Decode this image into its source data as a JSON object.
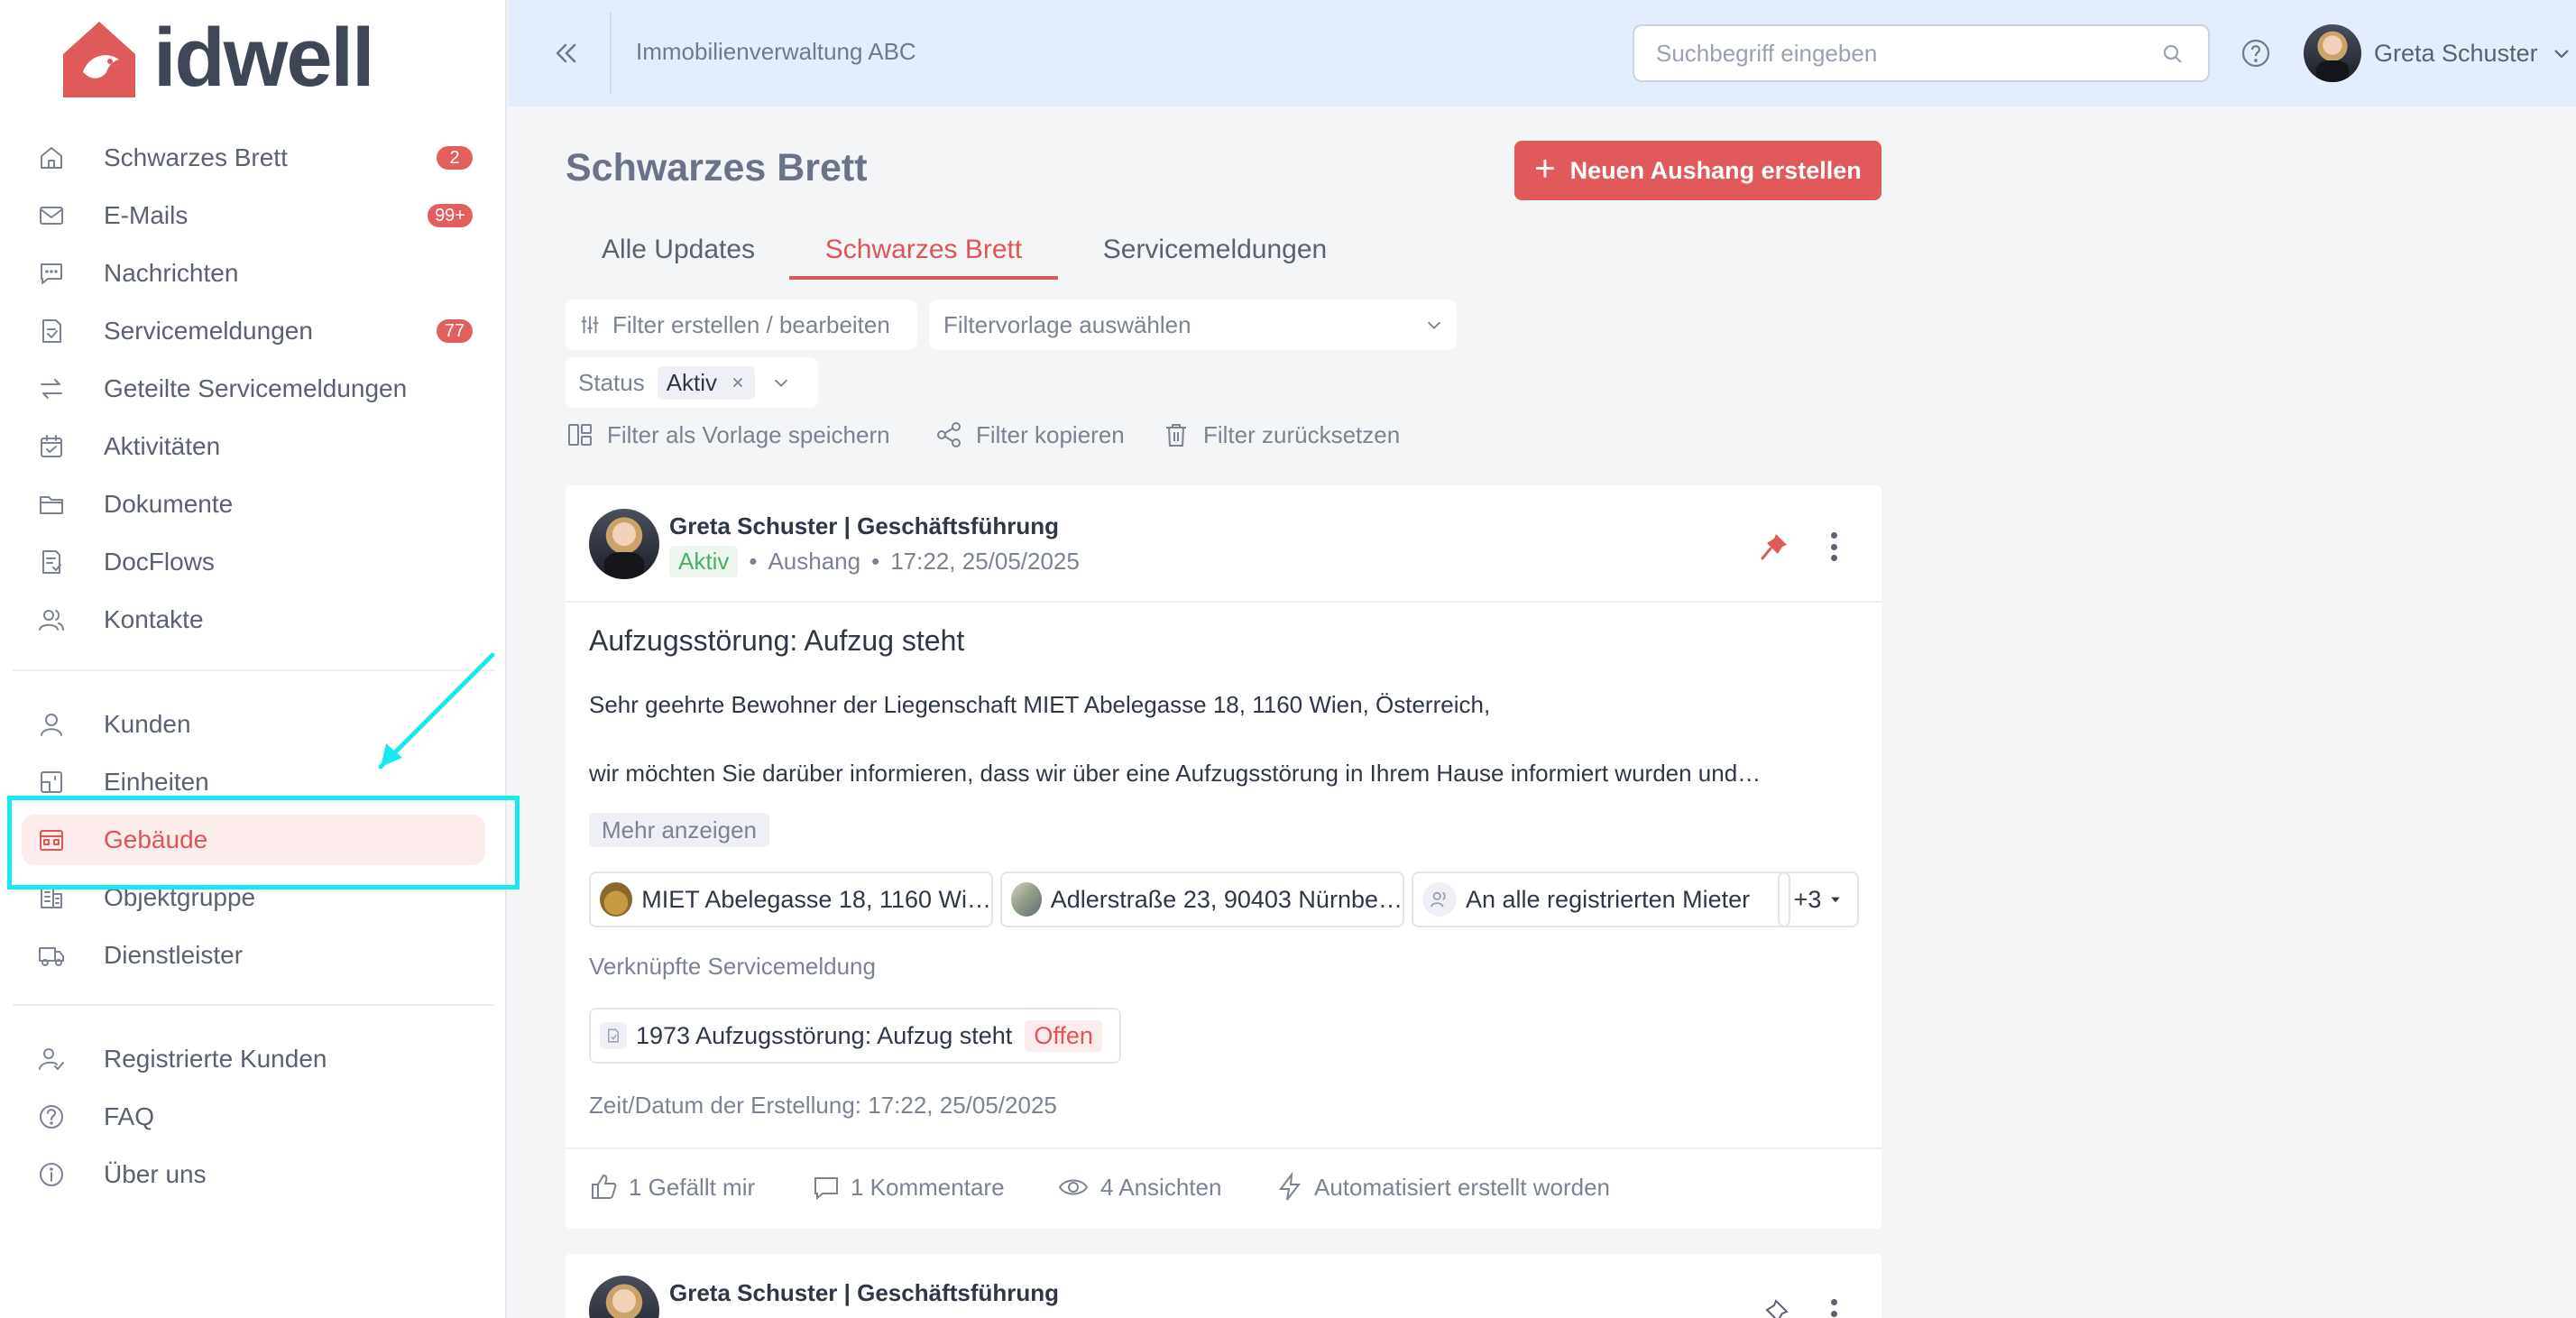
{
  "logo": {
    "text": "idwell"
  },
  "sidebar": {
    "items": [
      {
        "label": "Schwarzes Brett",
        "badge": "2",
        "icon": "home-icon"
      },
      {
        "label": "E-Mails",
        "badge": "99+",
        "icon": "mail-icon"
      },
      {
        "label": "Nachrichten",
        "badge": "",
        "icon": "chat-icon"
      },
      {
        "label": "Servicemeldungen",
        "badge": "77",
        "icon": "service-report-icon"
      },
      {
        "label": "Geteilte Servicemeldungen",
        "badge": "",
        "icon": "swap-arrows-icon"
      },
      {
        "label": "Aktivitäten",
        "badge": "",
        "icon": "calendar-check-icon"
      },
      {
        "label": "Dokumente",
        "badge": "",
        "icon": "folder-icon"
      },
      {
        "label": "DocFlows",
        "badge": "",
        "icon": "docflow-icon"
      },
      {
        "label": "Kontakte",
        "badge": "",
        "icon": "contacts-icon"
      },
      {
        "label": "Kunden",
        "badge": "",
        "icon": "user-icon"
      },
      {
        "label": "Einheiten",
        "badge": "",
        "icon": "unit-icon"
      },
      {
        "label": "Gebäude",
        "badge": "",
        "icon": "building-icon",
        "active": true
      },
      {
        "label": "Objektgruppe",
        "badge": "",
        "icon": "building-group-icon"
      },
      {
        "label": "Dienstleister",
        "badge": "",
        "icon": "truck-icon"
      },
      {
        "label": "Registrierte Kunden",
        "badge": "",
        "icon": "user-check-icon"
      },
      {
        "label": "FAQ",
        "badge": "",
        "icon": "question-circle-icon"
      },
      {
        "label": "Über uns",
        "badge": "",
        "icon": "info-circle-icon"
      }
    ]
  },
  "header": {
    "company": "Immobilienverwaltung ABC",
    "search_placeholder": "Suchbegriff eingeben",
    "user_name": "Greta Schuster"
  },
  "main": {
    "title": "Schwarzes Brett",
    "new_button": "Neuen Aushang erstellen",
    "tabs": [
      "Alle Updates",
      "Schwarzes Brett",
      "Servicemeldungen"
    ],
    "filter_edit": "Filter erstellen / bearbeiten",
    "filter_template": "Filtervorlage auswählen",
    "status_label": "Status",
    "status_value": "Aktiv",
    "actions": [
      "Filter als Vorlage speichern",
      "Filter kopieren",
      "Filter zurücksetzen"
    ]
  },
  "post": {
    "author": "Greta Schuster | Geschäftsführung",
    "status": "Aktiv",
    "type": "Aushang",
    "time": "17:22, 25/05/2025",
    "title": "Aufzugsstörung: Aufzug steht",
    "line1": "Sehr geehrte Bewohner der Liegenschaft MIET Abelegasse 18, 1160 Wien, Österreich,",
    "line2": "wir möchten Sie darüber informieren, dass wir über eine Aufzugsstörung in Ihrem Hause informiert wurden und…",
    "more": "Mehr anzeigen",
    "recipients": [
      "MIET Abelegasse 18, 1160 Wi…",
      "Adlerstraße 23, 90403 Nürnbe…",
      "An alle registrierten Mieter"
    ],
    "recipients_more": "+3",
    "linked_label": "Verknüpfte Servicemeldung",
    "linked_title": "1973 Aufzugsstörung: Aufzug steht",
    "linked_status": "Offen",
    "created": "Zeit/Datum der Erstellung: 17:22, 25/05/2025",
    "likes": "1 Gefällt mir",
    "comments": "1 Kommentare",
    "views": "4 Ansichten",
    "auto": "Automatisiert erstellt worden"
  },
  "post2": {
    "author": "Greta Schuster | Geschäftsführung"
  },
  "colors": {
    "accent": "#dd5555",
    "highlight": "#18e8f0",
    "header_bg": "#e3edfb"
  }
}
